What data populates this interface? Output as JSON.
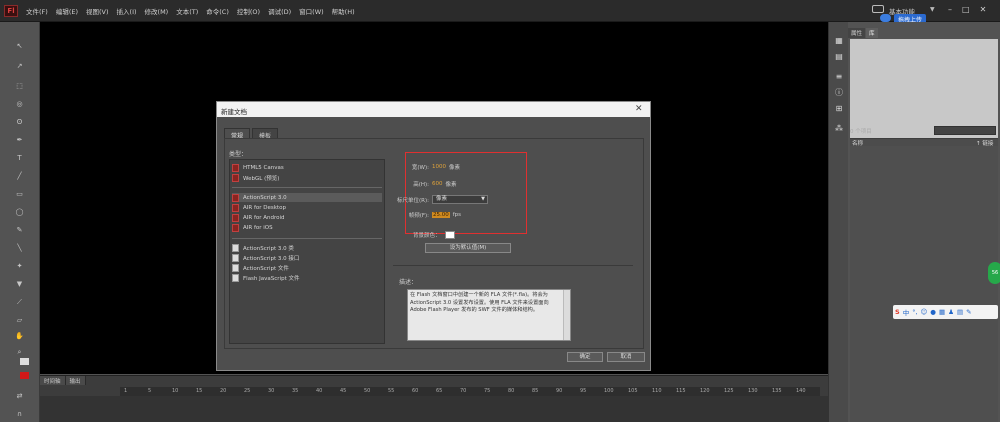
{
  "app": {
    "logo": "Fl"
  },
  "menu": [
    "文件(F)",
    "编辑(E)",
    "视图(V)",
    "插入(I)",
    "修改(M)",
    "文本(T)",
    "命令(C)",
    "控制(O)",
    "调试(D)",
    "窗口(W)",
    "帮助(H)"
  ],
  "workspace": {
    "label": "基本功能",
    "upload_label": "拖拽上传"
  },
  "dialog": {
    "title": "新建文档",
    "tabs": [
      "常规",
      "模板"
    ],
    "types_label": "类型：",
    "type_groups": [
      [
        "HTML5 Canvas",
        "WebGL (预览)"
      ],
      [
        "ActionScript 3.0",
        "AIR for Desktop",
        "AIR for Android",
        "AIR for iOS"
      ],
      [
        "ActionScript 3.0 类",
        "ActionScript 3.0 接口",
        "ActionScript 文件",
        "Flash JavaScript 文件"
      ]
    ],
    "selected_type": "ActionScript 3.0",
    "width_label": "宽(W):",
    "width_value": "1000",
    "width_unit": "像素",
    "height_label": "高(H):",
    "height_value": "600",
    "height_unit": "像素",
    "ruler_label": "标尺单位(R):",
    "ruler_value": "像素",
    "fps_label": "帧频(F):",
    "fps_value": "25.00",
    "fps_unit": "fps",
    "bg_label": "背景颜色：",
    "bg_color": "#ffffff",
    "default_button": "设为默认值(M)",
    "desc_label": "描述：",
    "desc_text": "在 Flash 文档窗口中创建一个新的 FLA 文件(*.fla)。将会为 ActionScript 3.0 设置发布设置。使用 FLA 文件来设置面向 Adobe Flash Player 发布的 SWF 文件的媒体和结构。",
    "ok_button": "确定",
    "cancel_button": "取消"
  },
  "timeline": {
    "tabs": [
      "时间轴",
      "输出"
    ],
    "frames": [
      "1",
      "5",
      "10",
      "15",
      "20",
      "25",
      "30",
      "35",
      "40",
      "45",
      "50",
      "55",
      "60",
      "65",
      "70",
      "75",
      "80",
      "85",
      "90",
      "95",
      "100",
      "105",
      "110",
      "115",
      "120",
      "125",
      "130",
      "135",
      "140"
    ]
  },
  "right_panel": {
    "tabs": [
      "属性",
      "库"
    ],
    "item_count": "0 个项目",
    "col_name": "名称",
    "col_link": "↑ 链接"
  },
  "ime": {
    "badge": "56",
    "brand": "S",
    "lang": "中"
  }
}
